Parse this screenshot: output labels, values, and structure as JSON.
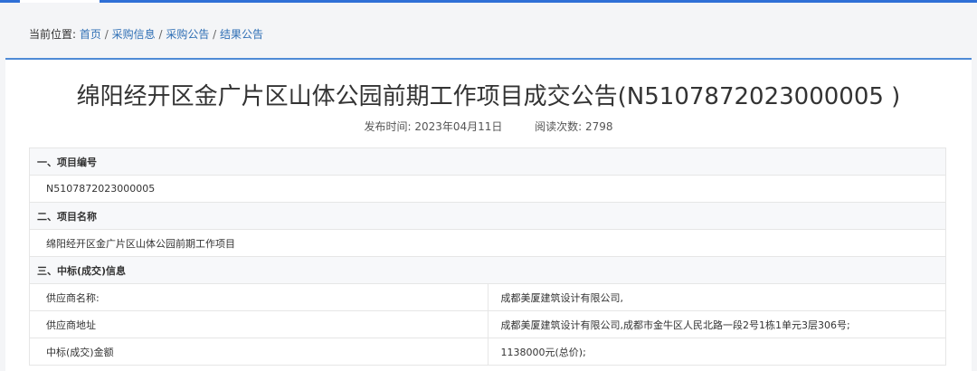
{
  "breadcrumb": {
    "prefix": "当前位置:",
    "items": [
      "首页",
      "采购信息",
      "采购公告",
      "结果公告"
    ],
    "separator": "/"
  },
  "article": {
    "title": "绵阳经开区金广片区山体公园前期工作项目成交公告(N5107872023000005 )",
    "publish_label": "发布时间:",
    "publish_date": "2023年04月11日",
    "views_label": "阅读次数:",
    "views": "2798"
  },
  "sections": [
    {
      "heading": "一、项目编号",
      "value": "N5107872023000005"
    },
    {
      "heading": "二、项目名称",
      "value": "绵阳经开区金广片区山体公园前期工作项目"
    },
    {
      "heading": "三、中标(成交)信息"
    }
  ],
  "award_rows": [
    {
      "label": "供应商名称:",
      "value": "成都美厦建筑设计有限公司,"
    },
    {
      "label": "供应商地址",
      "value": "成都美厦建筑设计有限公司,成都市金牛区人民北路一段2号1栋1单元3层306号;"
    },
    {
      "label": "中标(成交)金额",
      "value": "1138000元(总价);"
    }
  ],
  "colors": {
    "accent": "#2f6fd6",
    "link": "#2f6fb5",
    "panel_border": "#4f8bd6"
  }
}
